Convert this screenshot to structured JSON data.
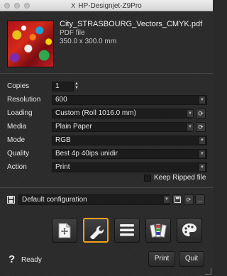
{
  "window": {
    "title": "HP-Designjet-Z9Pro",
    "close_glyph": "X"
  },
  "file": {
    "name": "City_STRASBOURG_Vectors_CMYK.pdf",
    "type": "PDF file",
    "size": "350.0 x 300.0 mm",
    "thumbnail_icon": "document-thumbnail"
  },
  "settings": {
    "copies": {
      "label": "Copies",
      "value": "1"
    },
    "resolution": {
      "label": "Resolution",
      "value": "600"
    },
    "loading": {
      "label": "Loading",
      "value": "Custom (Roll 1016.0 mm)"
    },
    "media": {
      "label": "Media",
      "value": "Plain Paper"
    },
    "mode": {
      "label": "Mode",
      "value": "RGB"
    },
    "quality": {
      "label": "Quality",
      "value": "Best 4p 40ips unidir"
    },
    "action": {
      "label": "Action",
      "value": "Print"
    }
  },
  "keep_ripped": {
    "label": "Keep Ripped file",
    "checked": false
  },
  "configuration": {
    "value": "Default configuration",
    "more_label": "..."
  },
  "toolbar": [
    "add-page",
    "settings-wrench",
    "menu-list",
    "color-swatches",
    "palette"
  ],
  "status": {
    "help": "?",
    "text": "Ready"
  },
  "buttons": {
    "print": "Print",
    "quit": "Quit"
  },
  "colors": {
    "accent": "#f0a11a",
    "background": "#2b2b2b",
    "field": "#1c1c1c"
  }
}
